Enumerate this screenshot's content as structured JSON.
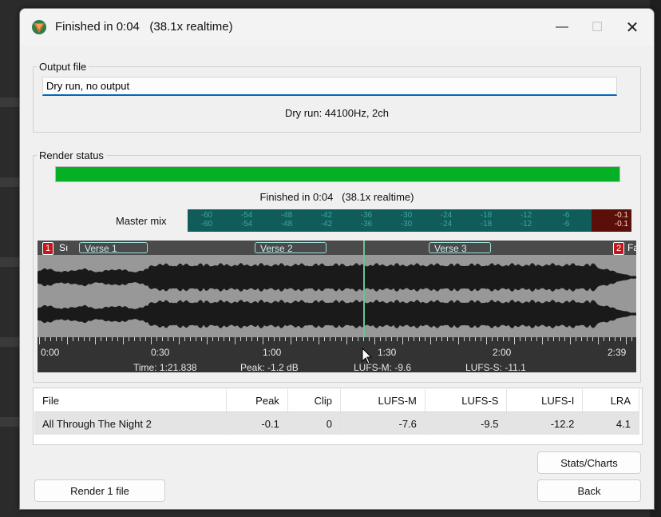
{
  "window": {
    "title": "Finished in 0:04   (38.1x realtime)",
    "controls": {
      "minimize": "—",
      "maximize": "☐",
      "close": "✕"
    }
  },
  "output_file": {
    "legend": "Output file",
    "value": "Dry run, no output",
    "info": "Dry run: 44100Hz, 2ch"
  },
  "render_status": {
    "legend": "Render status",
    "progress": 1.0,
    "progress_color": "#06b025",
    "finished_text": "Finished in 0:04   (38.1x realtime)",
    "master_label": "Master mix",
    "meter_ticks": [
      "-60",
      "-54",
      "-48",
      "-42",
      "-36",
      "-30",
      "-24",
      "-18",
      "-12",
      "-6"
    ],
    "meter_peak": "-0.1"
  },
  "waveform": {
    "markers": [
      {
        "num": "1",
        "label": "Sı"
      },
      {
        "num": "2",
        "label": "Fa"
      }
    ],
    "regions": [
      "Verse 1",
      "Verse 2",
      "Verse 3"
    ],
    "ruler_ticks": [
      "0:00",
      "0:30",
      "1:00",
      "1:30",
      "2:00",
      "2:39"
    ],
    "stats": {
      "time": "Time: 1:21.838",
      "peak": "Peak: -1.2 dB",
      "lufs_m": "LUFS-M: -9.6",
      "lufs_s": "LUFS-S: -11.1"
    }
  },
  "table": {
    "headers": [
      "File",
      "Peak",
      "Clip",
      "LUFS-M",
      "LUFS-S",
      "LUFS-I",
      "LRA"
    ],
    "rows": [
      [
        "All Through The Night 2",
        "-0.1",
        "0",
        "-7.6",
        "-9.5",
        "-12.2",
        "4.1"
      ]
    ]
  },
  "buttons": {
    "stats": "Stats/Charts",
    "back": "Back",
    "render": "Render 1 file"
  }
}
